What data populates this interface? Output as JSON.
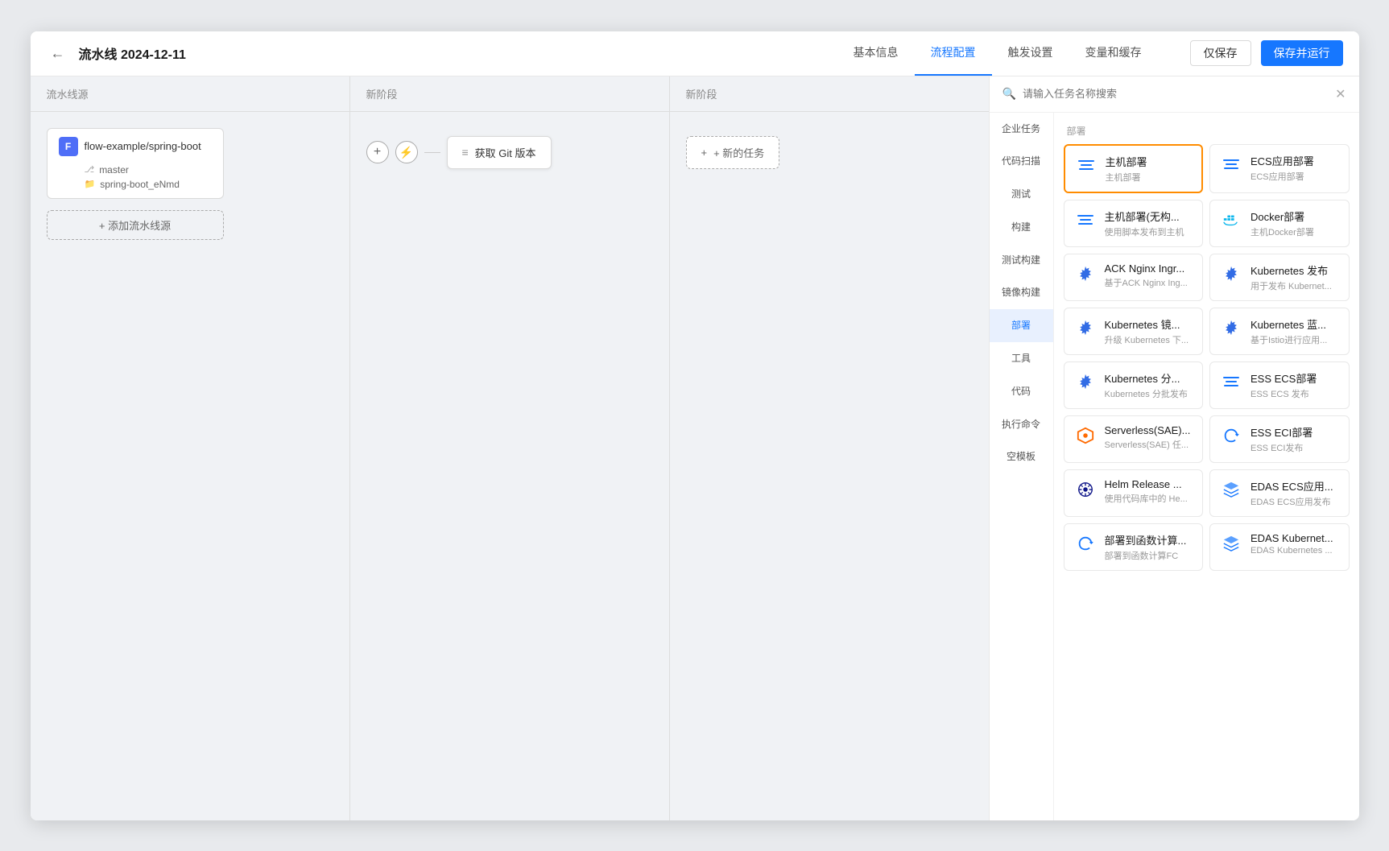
{
  "header": {
    "back_label": "←",
    "title": "流水线 2024-12-11",
    "nav_items": [
      {
        "label": "基本信息",
        "active": false
      },
      {
        "label": "流程配置",
        "active": true
      },
      {
        "label": "触发设置",
        "active": false
      },
      {
        "label": "变量和缓存",
        "active": false
      }
    ],
    "btn_save_only": "仅保存",
    "btn_save_run": "保存并运行"
  },
  "canvas": {
    "col_headers": [
      "流水线源",
      "新阶段",
      "新阶段"
    ],
    "source": {
      "icon": "F",
      "name": "flow-example/spring-boot",
      "branch": "master",
      "folder": "spring-boot_eNmd"
    },
    "add_source": "+ 添加流水线源",
    "task_node": "获取 Git 版本",
    "new_task": "+ 新的任务"
  },
  "right_panel": {
    "search_placeholder": "请输入任务名称搜索",
    "categories": [
      {
        "label": "企业任务",
        "active": false
      },
      {
        "label": "代码扫描",
        "active": false
      },
      {
        "label": "测试",
        "active": false
      },
      {
        "label": "构建",
        "active": false
      },
      {
        "label": "测试构建",
        "active": false
      },
      {
        "label": "镜像构建",
        "active": false
      },
      {
        "label": "部署",
        "active": true
      },
      {
        "label": "工具",
        "active": false
      },
      {
        "label": "代码",
        "active": false
      },
      {
        "label": "执行命令",
        "active": false
      },
      {
        "label": "空模板",
        "active": false
      }
    ],
    "section_title": "部署",
    "tasks": [
      {
        "name": "主机部署",
        "desc": "主机部署",
        "icon_type": "lines",
        "selected": true
      },
      {
        "name": "ECS应用部署",
        "desc": "ECS应用部署",
        "icon_type": "lines",
        "selected": false
      },
      {
        "name": "主机部署(无构...",
        "desc": "使用脚本发布到主机",
        "icon_type": "lines",
        "selected": false
      },
      {
        "name": "Docker部署",
        "desc": "主机Docker部署",
        "icon_type": "docker",
        "selected": false
      },
      {
        "name": "ACK Nginx Ingr...",
        "desc": "基于ACK Nginx Ing...",
        "icon_type": "gear",
        "selected": false
      },
      {
        "name": "Kubernetes 发布",
        "desc": "用于发布 Kubernet...",
        "icon_type": "gear",
        "selected": false
      },
      {
        "name": "Kubernetes 镜...",
        "desc": "升级 Kubernetes 下...",
        "icon_type": "gear",
        "selected": false
      },
      {
        "name": "Kubernetes 蓝...",
        "desc": "基于Istio进行应用...",
        "icon_type": "gear",
        "selected": false
      },
      {
        "name": "Kubernetes 分...",
        "desc": "Kubernetes 分批发布",
        "icon_type": "gear",
        "selected": false
      },
      {
        "name": "ESS ECS部署",
        "desc": "ESS ECS 发布",
        "icon_type": "lines",
        "selected": false
      },
      {
        "name": "Serverless(SAE)...",
        "desc": "Serverless(SAE) 任...",
        "icon_type": "hexagon",
        "selected": false
      },
      {
        "name": "ESS ECI部署",
        "desc": "ESS ECI发布",
        "icon_type": "cycle",
        "selected": false
      },
      {
        "name": "Helm Release ...",
        "desc": "使用代码库中的 He...",
        "icon_type": "gear2",
        "selected": false
      },
      {
        "name": "EDAS ECS应用...",
        "desc": "EDAS ECS应用发布",
        "icon_type": "shield",
        "selected": false
      },
      {
        "name": "部署到函数计算...",
        "desc": "部署到函数计算FC",
        "icon_type": "cycle",
        "selected": false
      },
      {
        "name": "EDAS Kubernet...",
        "desc": "EDAS Kubernetes ...",
        "icon_type": "shield",
        "selected": false
      }
    ]
  }
}
